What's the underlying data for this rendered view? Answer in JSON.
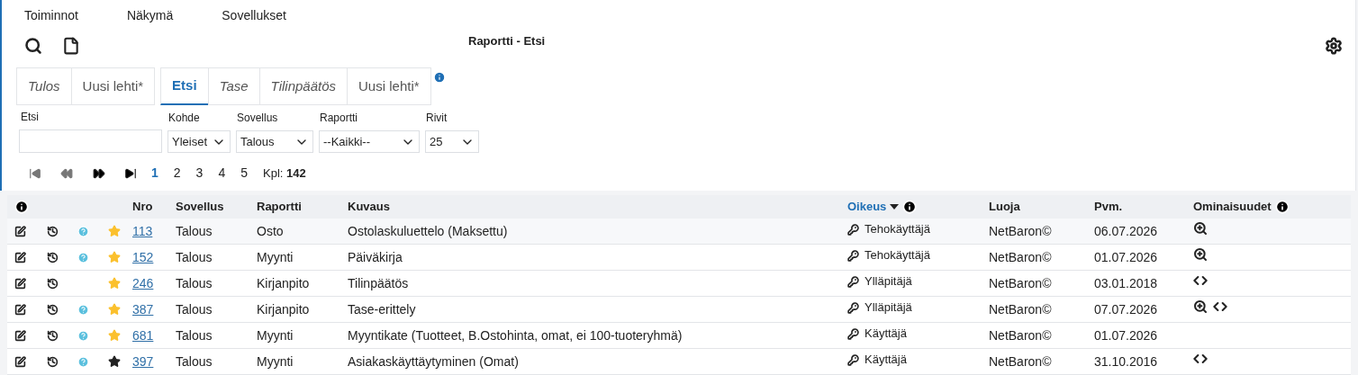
{
  "menu": [
    "Toiminnot",
    "Näkymä",
    "Sovellukset"
  ],
  "title": "Raportti - Etsi",
  "tab_groups": [
    [
      {
        "label": "Tulos",
        "italic": true,
        "selected": false
      },
      {
        "label": "Uusi lehti*",
        "italic": false,
        "selected": false
      }
    ],
    [
      {
        "label": "Etsi",
        "italic": false,
        "selected": true
      },
      {
        "label": "Tase",
        "italic": true,
        "selected": false
      },
      {
        "label": "Tilinpäätös",
        "italic": true,
        "selected": false
      },
      {
        "label": "Uusi lehti*",
        "italic": false,
        "selected": false
      }
    ]
  ],
  "filters": {
    "search": {
      "label": "Etsi"
    },
    "selects": [
      {
        "label": "Kohde",
        "value": "Yleiset"
      },
      {
        "label": "Sovellus",
        "value": "Talous"
      },
      {
        "label": "Raportti",
        "value": "--Kaikki--"
      },
      {
        "label": "Rivit",
        "value": "25"
      }
    ]
  },
  "pager": {
    "pages": [
      {
        "label": "1",
        "selected": true
      },
      {
        "label": "2",
        "selected": false
      },
      {
        "label": "3",
        "selected": false
      },
      {
        "label": "4",
        "selected": false
      },
      {
        "label": "5",
        "selected": false
      }
    ],
    "count": "Kpl: **142**"
  },
  "table": {
    "columns": [
      {
        "label": "Nro",
        "sorted": false,
        "info": false
      },
      {
        "label": "Sovellus",
        "sorted": false,
        "info": false
      },
      {
        "label": "Raportti",
        "sorted": false,
        "info": false
      },
      {
        "label": "Kuvaus",
        "sorted": false,
        "info": false
      },
      {
        "label": "Oikeus",
        "sorted": true,
        "info": true
      },
      {
        "label": "Luoja",
        "sorted": false,
        "info": false
      },
      {
        "label": "Pvm.",
        "sorted": false,
        "info": false
      },
      {
        "label": "Ominaisuudet",
        "sorted": false,
        "info": true
      }
    ],
    "rows": [
      {
        "help": true,
        "starred": true,
        "nro": "113",
        "sovellus": "Talous",
        "raportti": "Osto",
        "kuvaus": "Ostolaskuluettelo (Maksettu)",
        "oikeus": "Tehokäyttäjä",
        "luoja": "NetBaron©",
        "pvm": "06.07.2026",
        "features": [
          {
            "kind": "search"
          }
        ]
      },
      {
        "help": true,
        "starred": true,
        "nro": "152",
        "sovellus": "Talous",
        "raportti": "Myynti",
        "kuvaus": "Päiväkirja",
        "oikeus": "Tehokäyttäjä",
        "luoja": "NetBaron©",
        "pvm": "01.07.2026",
        "features": [
          {
            "kind": "search"
          }
        ]
      },
      {
        "help": false,
        "starred": true,
        "nro": "246",
        "sovellus": "Talous",
        "raportti": "Kirjanpito",
        "kuvaus": "Tilinpäätös",
        "oikeus": "Ylläpitäjä",
        "luoja": "NetBaron©",
        "pvm": "03.01.2018",
        "features": [
          {
            "kind": "code"
          }
        ]
      },
      {
        "help": true,
        "starred": true,
        "nro": "387",
        "sovellus": "Talous",
        "raportti": "Kirjanpito",
        "kuvaus": "Tase-erittely",
        "oikeus": "Ylläpitäjä",
        "luoja": "NetBaron©",
        "pvm": "07.07.2026",
        "features": [
          {
            "kind": "search"
          },
          {
            "kind": "code"
          }
        ]
      },
      {
        "help": true,
        "starred": true,
        "nro": "681",
        "sovellus": "Talous",
        "raportti": "Myynti",
        "kuvaus": "Myyntikate (Tuotteet, B.Ostohinta, omat, ei 100-tuoteryhmä)",
        "oikeus": "Käyttäjä",
        "luoja": "NetBaron©",
        "pvm": "01.07.2026",
        "features": []
      },
      {
        "help": true,
        "starred": false,
        "nro": "397",
        "sovellus": "Talous",
        "raportti": "Myynti",
        "kuvaus": "Asiakaskäyttäytyminen (Omat)",
        "oikeus": "Käyttäjä",
        "luoja": "NetBaron©",
        "pvm": "31.10.2016",
        "features": [
          {
            "kind": "code"
          }
        ]
      }
    ]
  }
}
